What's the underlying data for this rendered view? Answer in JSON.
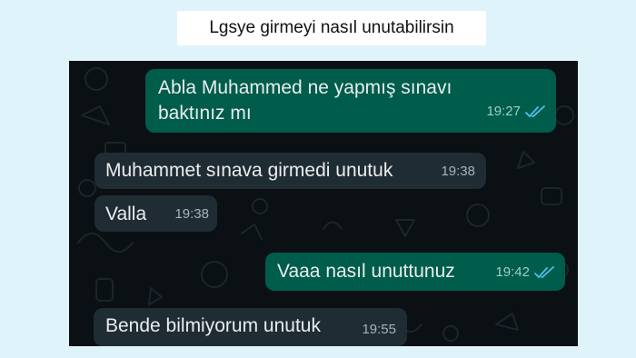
{
  "caption": "Lgsye girmeyi nasıl unutabilirsin",
  "colors": {
    "page_bg": "#dff3fb",
    "chat_bg": "#0b1014",
    "outgoing_bubble": "#005c4b",
    "incoming_bubble": "#202c33",
    "read_ticks": "#53bdeb"
  },
  "messages": [
    {
      "direction": "outgoing",
      "lines": [
        "Abla Muhammed ne yapmış sınavı",
        "baktınız mı"
      ],
      "time": "19:27",
      "status": "read",
      "status_icon": "double-check-icon"
    },
    {
      "direction": "incoming",
      "lines": [
        "Muhammet sınava girmedi unutuk"
      ],
      "time": "19:38"
    },
    {
      "direction": "incoming",
      "lines": [
        "Valla"
      ],
      "time": "19:38"
    },
    {
      "direction": "outgoing",
      "lines": [
        "Vaaa nasıl unuttunuz"
      ],
      "time": "19:42",
      "status": "read",
      "status_icon": "double-check-icon"
    },
    {
      "direction": "incoming",
      "lines": [
        "Bende bilmiyorum unutuk"
      ],
      "time": "19:55"
    }
  ]
}
